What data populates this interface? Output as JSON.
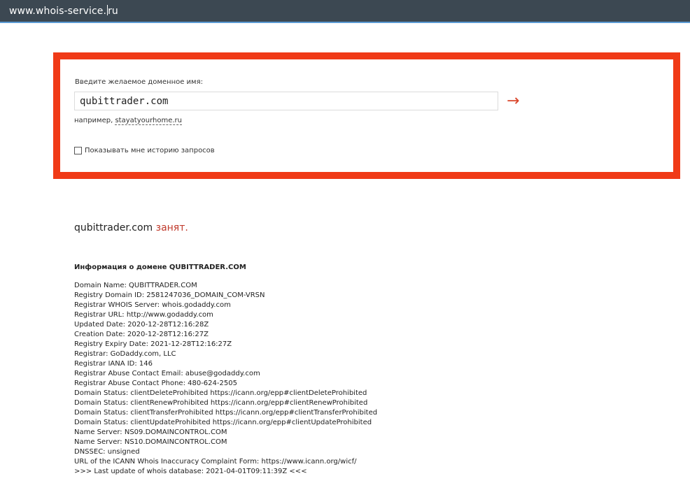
{
  "browser": {
    "url_prefix": "www.whois-service",
    "url_suffix": "ru"
  },
  "search": {
    "label": "Введите желаемое доменное имя:",
    "value": "qubittrader.com",
    "submit_glyph": "→",
    "example_prefix": "например,",
    "example_link": "stayatyourhome.ru",
    "history_label": "Показывать мне историю запросов",
    "history_checked": false
  },
  "result": {
    "domain": "qubittrader.com",
    "status": "занят."
  },
  "info": {
    "heading": "Информация о домене QUBITTRADER.COM",
    "lines": [
      "Domain Name: QUBITTRADER.COM",
      "Registry Domain ID: 2581247036_DOMAIN_COM-VRSN",
      "Registrar WHOIS Server: whois.godaddy.com",
      "Registrar URL: http://www.godaddy.com",
      "Updated Date: 2020-12-28T12:16:28Z",
      "Creation Date: 2020-12-28T12:16:27Z",
      "Registry Expiry Date: 2021-12-28T12:16:27Z",
      "Registrar: GoDaddy.com, LLC",
      "Registrar IANA ID: 146",
      "Registrar Abuse Contact Email: abuse@godaddy.com",
      "Registrar Abuse Contact Phone: 480-624-2505",
      "Domain Status: clientDeleteProhibited https://icann.org/epp#clientDeleteProhibited",
      "Domain Status: clientRenewProhibited https://icann.org/epp#clientRenewProhibited",
      "Domain Status: clientTransferProhibited https://icann.org/epp#clientTransferProhibited",
      "Domain Status: clientUpdateProhibited https://icann.org/epp#clientUpdateProhibited",
      "Name Server: NS09.DOMAINCONTROL.COM",
      "Name Server: NS10.DOMAINCONTROL.COM",
      "DNSSEC: unsigned",
      "URL of the ICANN Whois Inaccuracy Complaint Form: https://www.icann.org/wicf/",
      ">>> Last update of whois database: 2021-04-01T09:11:39Z <<<"
    ]
  }
}
